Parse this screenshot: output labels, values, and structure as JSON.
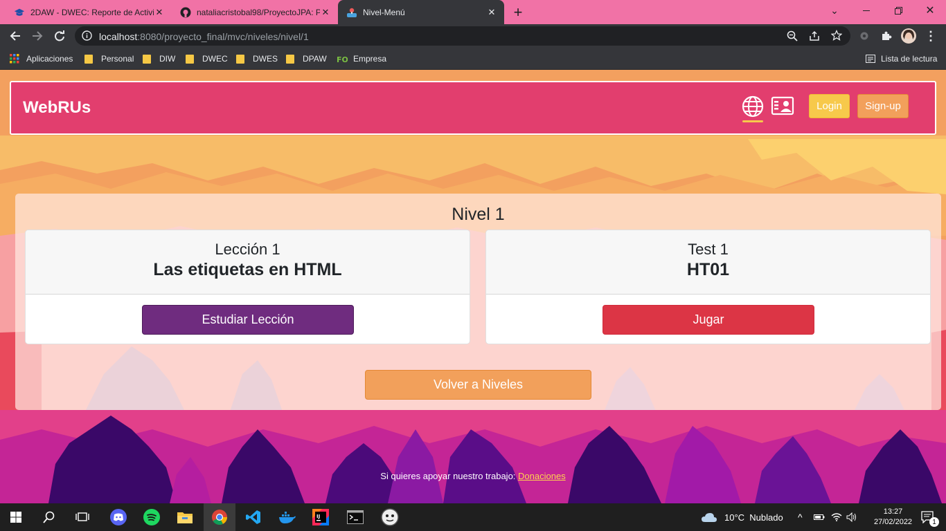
{
  "browser": {
    "tabs": [
      {
        "title": "2DAW - DWEC: Reporte de Activid",
        "icon": "moodle-cap-icon"
      },
      {
        "title": "nataliacristobal98/ProyectoJPA: P",
        "icon": "github-icon"
      },
      {
        "title": "Nivel-Menú",
        "icon": "game-icon",
        "active": true
      }
    ],
    "new_tab_label": "+",
    "url_host": "localhost",
    "url_rest": ":8080/proyecto_final/mvc/niveles/nivel/1",
    "bookmarks": [
      {
        "label": "Aplicaciones",
        "icon": "apps-grid-icon"
      },
      {
        "label": "Personal",
        "icon": "folder-icon"
      },
      {
        "label": "DIW",
        "icon": "folder-icon"
      },
      {
        "label": "DWEC",
        "icon": "folder-icon"
      },
      {
        "label": "DWES",
        "icon": "folder-icon"
      },
      {
        "label": "DPAW",
        "icon": "folder-icon"
      },
      {
        "label": "Empresa",
        "icon": "fol-icon"
      }
    ],
    "reading_list": "Lista de lectura"
  },
  "navbar": {
    "brand": "WebRUs",
    "login": "Login",
    "signup": "Sign-up"
  },
  "level": {
    "title": "Nivel 1",
    "lesson": {
      "subtitle": "Lección 1",
      "title": "Las etiquetas en HTML",
      "button": "Estudiar Lección"
    },
    "test": {
      "subtitle": "Test 1",
      "title": "HT01",
      "button": "Jugar"
    },
    "back_button": "Volver a Niveles"
  },
  "footer": {
    "text": "Si quieres apoyar nuestro trabajo: ",
    "link": "Donaciones"
  },
  "taskbar": {
    "weather": "10°C  Nublado",
    "time": "13:27",
    "date": "27/02/2022",
    "notifications": "1"
  },
  "colors": {
    "navbar": "#e23e6e",
    "login_btn": "#f7c94b",
    "signup_btn": "#f2a05b",
    "lesson_btn": "#6f2c7f",
    "test_btn": "#dc3545",
    "back_btn": "#f2a05b",
    "tabbar": "#f172a6"
  }
}
